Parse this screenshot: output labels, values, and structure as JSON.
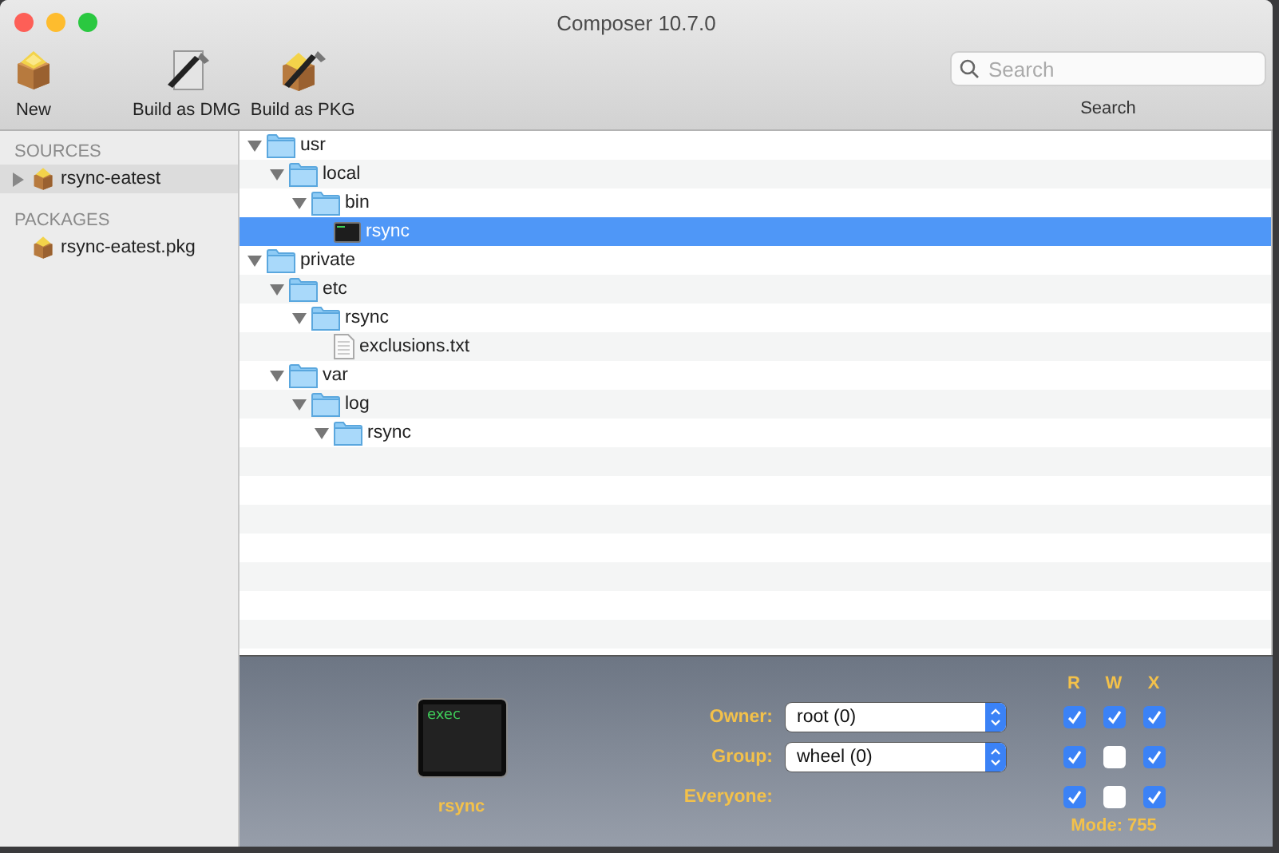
{
  "window": {
    "title": "Composer 10.7.0"
  },
  "toolbar": {
    "items": [
      {
        "label": "New",
        "kind": "package"
      },
      {
        "label": "Build as DMG",
        "kind": "dmg"
      },
      {
        "label": "Build as PKG",
        "kind": "pkg"
      }
    ],
    "search": {
      "placeholder": "Search",
      "label": "Search"
    }
  },
  "sidebar": {
    "sections": [
      {
        "heading": "SOURCES",
        "kind": "source",
        "items": [
          {
            "label": "rsync-eatest",
            "expanded": false,
            "selected": true
          }
        ]
      },
      {
        "heading": "PACKAGES",
        "kind": "package",
        "items": [
          {
            "label": "rsync-eatest.pkg",
            "selected": false
          }
        ]
      }
    ]
  },
  "tree": [
    {
      "name": "usr",
      "kind": "folder",
      "expanded": true,
      "selected": false,
      "children": [
        {
          "name": "local",
          "kind": "folder",
          "expanded": true,
          "selected": false,
          "children": [
            {
              "name": "bin",
              "kind": "folder",
              "expanded": true,
              "selected": false,
              "children": [
                {
                  "name": "rsync",
                  "kind": "exec",
                  "selected": true
                }
              ]
            }
          ]
        }
      ]
    },
    {
      "name": "private",
      "kind": "folder",
      "expanded": true,
      "selected": false,
      "children": [
        {
          "name": "etc",
          "kind": "folder",
          "expanded": true,
          "selected": false,
          "children": [
            {
              "name": "rsync",
              "kind": "folder",
              "expanded": true,
              "selected": false,
              "children": [
                {
                  "name": "exclusions.txt",
                  "kind": "file",
                  "selected": false
                }
              ]
            }
          ]
        },
        {
          "name": "var",
          "kind": "folder",
          "expanded": true,
          "selected": false,
          "children": [
            {
              "name": "log",
              "kind": "folder",
              "expanded": true,
              "selected": false,
              "children": [
                {
                  "name": "rsync",
                  "kind": "folder",
                  "expanded": true,
                  "selected": false
                }
              ]
            }
          ]
        }
      ]
    }
  ],
  "info": {
    "icon_text": "exec",
    "name": "rsync",
    "columns": [
      "R",
      "W",
      "X"
    ],
    "rows": [
      {
        "label": "Owner:",
        "value": "root (0)",
        "checks": [
          {
            "checked": true
          },
          {
            "checked": true
          },
          {
            "checked": true
          }
        ]
      },
      {
        "label": "Group:",
        "value": "wheel (0)",
        "checks": [
          {
            "checked": true
          },
          {
            "checked": false
          },
          {
            "checked": true
          }
        ]
      },
      {
        "label": "Everyone:",
        "checks": [
          {
            "checked": true
          },
          {
            "checked": false
          },
          {
            "checked": true
          }
        ]
      }
    ],
    "mode": "Mode: 755"
  }
}
